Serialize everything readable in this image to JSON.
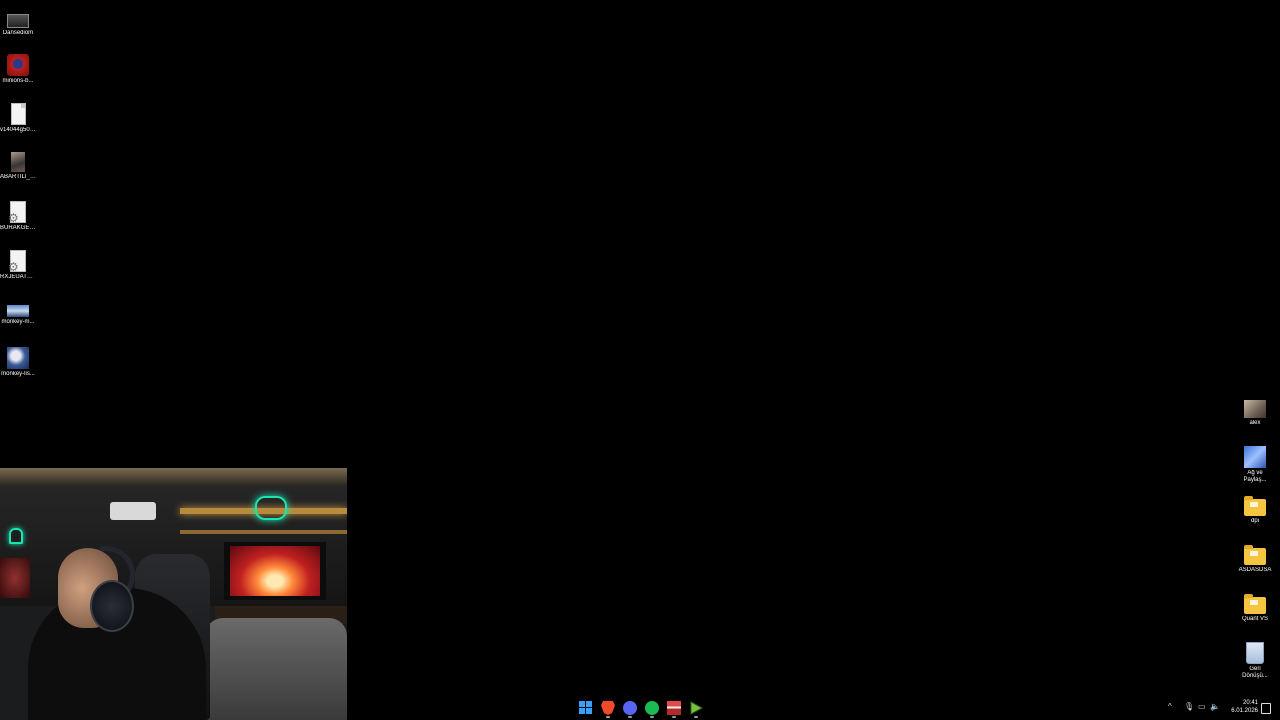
{
  "desktop": {
    "left_icons": [
      {
        "label": "Dansediom",
        "icon": "media-player-icon"
      },
      {
        "label": "minions-b...",
        "icon": "image-file-icon"
      },
      {
        "label": "v14044g500...",
        "icon": "document-file-icon"
      },
      {
        "label": "ABARTILI_2...",
        "icon": "photo-file-icon"
      },
      {
        "label": "BURAKGEN...",
        "icon": "settings-file-icon"
      },
      {
        "label": "RXJEUATTIGI",
        "icon": "settings-file-icon"
      },
      {
        "label": "monkey-m...",
        "icon": "image-file-icon"
      },
      {
        "label": "monkey-lis...",
        "icon": "image-file-icon"
      }
    ],
    "right_icons": [
      {
        "label": "alex",
        "icon": "user-folder-icon"
      },
      {
        "label": "Ağ ve Paylaş...",
        "icon": "network-icon"
      },
      {
        "label": "dpi",
        "icon": "folder-icon"
      },
      {
        "label": "ASDASDSA",
        "icon": "folder-icon"
      },
      {
        "label": "Quant VS",
        "icon": "folder-icon"
      },
      {
        "label": "Geri Dönüşü...",
        "icon": "recycle-bin-icon"
      }
    ]
  },
  "webcam": {
    "icon": "webcam-feed"
  },
  "taskbar": {
    "apps": [
      {
        "name": "start",
        "icon": "windows-start-icon"
      },
      {
        "name": "brave",
        "icon": "brave-browser-icon"
      },
      {
        "name": "discord",
        "icon": "discord-icon"
      },
      {
        "name": "spotify",
        "icon": "spotify-icon"
      },
      {
        "name": "app-red",
        "icon": "app-icon"
      },
      {
        "name": "play",
        "icon": "play-app-icon"
      }
    ],
    "tray": {
      "time": "20:41",
      "date": "6.01.2026"
    },
    "colors": {
      "accent": "#3aa0ff"
    }
  }
}
